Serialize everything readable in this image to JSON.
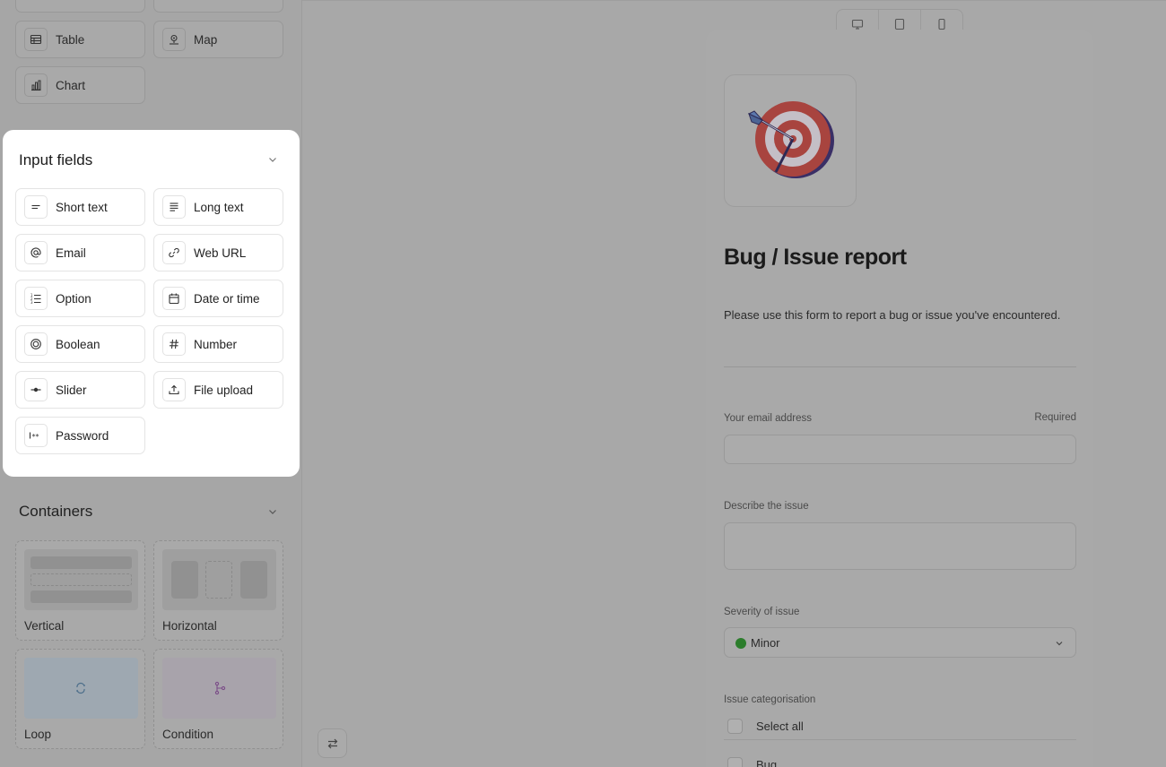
{
  "sidebar": {
    "top_tiles": [
      {
        "label": "Table",
        "icon": "table-icon"
      },
      {
        "label": "Map",
        "icon": "map-pin-icon"
      },
      {
        "label": "Chart",
        "icon": "bar-chart-icon"
      }
    ],
    "input_fields": {
      "title": "Input fields",
      "items": [
        {
          "label": "Short text",
          "icon": "short-text-icon"
        },
        {
          "label": "Long text",
          "icon": "long-text-icon"
        },
        {
          "label": "Email",
          "icon": "at-sign-icon"
        },
        {
          "label": "Web URL",
          "icon": "link-icon"
        },
        {
          "label": "Option",
          "icon": "list-icon"
        },
        {
          "label": "Date or time",
          "icon": "calendar-icon"
        },
        {
          "label": "Boolean",
          "icon": "toggle-circle-icon"
        },
        {
          "label": "Number",
          "icon": "hash-icon"
        },
        {
          "label": "Slider",
          "icon": "slider-icon"
        },
        {
          "label": "File upload",
          "icon": "upload-icon"
        },
        {
          "label": "Password",
          "icon": "password-icon"
        }
      ]
    },
    "containers": {
      "title": "Containers",
      "items": [
        {
          "label": "Vertical"
        },
        {
          "label": "Horizontal"
        },
        {
          "label": "Loop"
        },
        {
          "label": "Condition"
        }
      ]
    }
  },
  "form": {
    "title": "Bug / Issue report",
    "description": "Please use this form to report a bug or issue you've encountered.",
    "email_label": "Your email address",
    "email_required": "Required",
    "describe_label": "Describe the issue",
    "severity_label": "Severity of issue",
    "severity_value": "Minor",
    "categorisation_label": "Issue categorisation",
    "options": [
      "Select all",
      "Bug"
    ]
  },
  "colors": {
    "overlay": "#a8a8a8",
    "panel": "#ffffff",
    "severity_dot": "#2c7d2c"
  }
}
